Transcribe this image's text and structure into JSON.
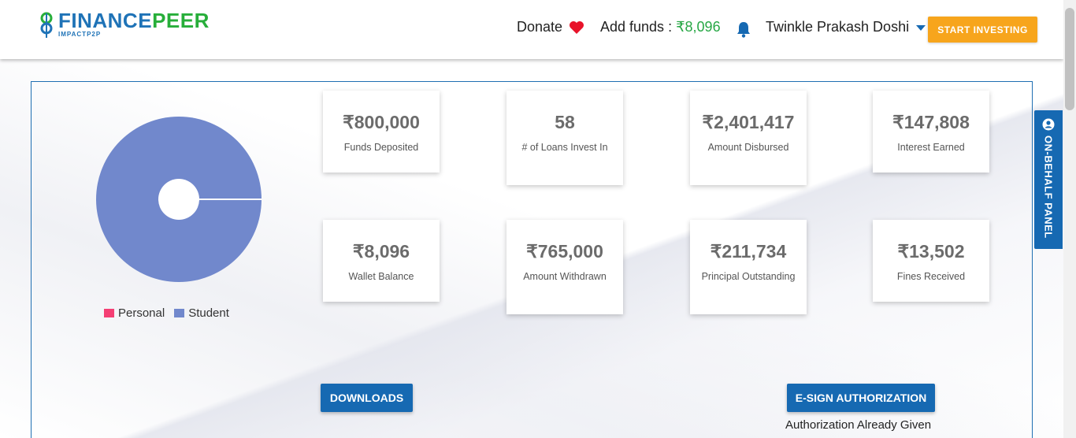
{
  "header": {
    "logo_main_a": "FINANCE",
    "logo_main_b": "PEER",
    "logo_sub": "IMPACTP2P",
    "donate_label": "Donate",
    "add_funds_label": "Add funds : ",
    "add_funds_amount": "₹8,096",
    "user_name": "Twinkle Prakash Doshi",
    "start_investing_label": "START INVESTING"
  },
  "chart_data": {
    "type": "pie",
    "categories": [
      "Personal",
      "Student"
    ],
    "values": [
      0,
      100
    ],
    "colors": [
      "#f43f74",
      "#7188cc"
    ],
    "legend_position": "bottom"
  },
  "legend": [
    {
      "label": "Personal",
      "color": "#f43f74"
    },
    {
      "label": "Student",
      "color": "#7188cc"
    }
  ],
  "cards": [
    {
      "value": "₹800,000",
      "label": "Funds Deposited"
    },
    {
      "value": "58",
      "label": "# of Loans Invest In"
    },
    {
      "value": "₹2,401,417",
      "label": "Amount Disbursed"
    },
    {
      "value": "₹147,808",
      "label": "Interest Earned"
    },
    {
      "value": "₹8,096",
      "label": "Wallet Balance"
    },
    {
      "value": "₹765,000",
      "label": "Amount Withdrawn"
    },
    {
      "value": "₹211,734",
      "label": "Principal Outstanding"
    },
    {
      "value": "₹13,502",
      "label": "Fines Received"
    }
  ],
  "actions": {
    "downloads_label": "DOWNLOADS",
    "esign_label": "E-SIGN AUTHORIZATION",
    "auth_status": "Authorization Already Given"
  },
  "side_panel": {
    "label": "ON-BEHALF PANEL"
  },
  "colors": {
    "brand_blue": "#1669b2",
    "brand_green": "#27ae3a",
    "accent_orange": "#f7a51c",
    "heart_red": "#e8132a"
  }
}
